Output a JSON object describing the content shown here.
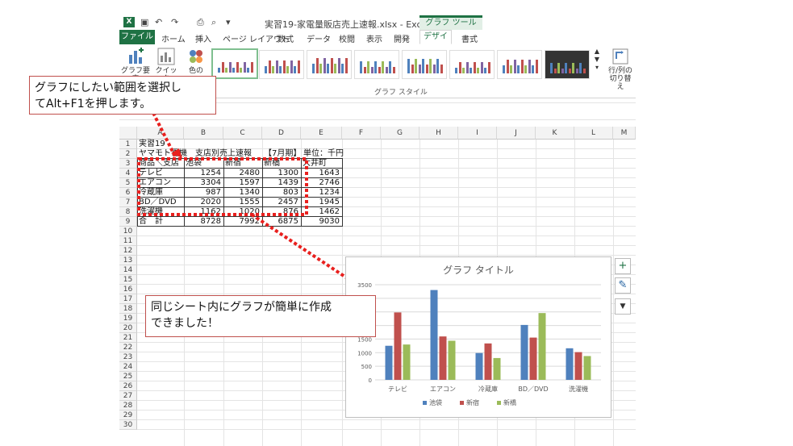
{
  "window": {
    "app_icon_letter": "X",
    "title": "実習19-家電量販店売上速報.xlsx - Excel",
    "context_tools_label": "グラフ ツール"
  },
  "tabs": [
    {
      "label": "ファイル"
    },
    {
      "label": "ホーム"
    },
    {
      "label": "挿入"
    },
    {
      "label": "ページ レイアウト"
    },
    {
      "label": "数式"
    },
    {
      "label": "データ"
    },
    {
      "label": "校閲"
    },
    {
      "label": "表示"
    },
    {
      "label": "開発"
    },
    {
      "label": "デザイン"
    },
    {
      "label": "書式"
    }
  ],
  "ribbon": {
    "add_element": "グラフ要素",
    "quick_layout": "クイック",
    "change_color": "色の",
    "switch_row_col_1": "行/列の",
    "switch_row_col_2": "切り替え",
    "group_styles_label": "グラフ スタイル"
  },
  "sheet": {
    "columns": [
      "A",
      "B",
      "C",
      "D",
      "E",
      "F",
      "G",
      "H",
      "I",
      "J",
      "K",
      "L",
      "M"
    ],
    "rows": [
      "1",
      "2",
      "3",
      "4",
      "5",
      "6",
      "7",
      "8",
      "9",
      "10",
      "11",
      "12",
      "13",
      "14",
      "15",
      "16",
      "17",
      "18",
      "19",
      "20",
      "21",
      "22",
      "23",
      "24",
      "25",
      "26",
      "27",
      "28",
      "29",
      "30"
    ],
    "title": "実習19",
    "subtitle": "ヤマモト電機　支店別売上速報",
    "period": "【7月期】",
    "unit": "単位：千円",
    "headers": [
      "商品＼支店",
      "池袋",
      "新宿",
      "新橋",
      "大井町"
    ],
    "data_rows": [
      {
        "name": "テレビ",
        "values": [
          "1254",
          "2480",
          "1300",
          "1643"
        ]
      },
      {
        "name": "エアコン",
        "values": [
          "3304",
          "1597",
          "1439",
          "2746"
        ]
      },
      {
        "name": "冷蔵庫",
        "values": [
          "987",
          "1340",
          "803",
          "1234"
        ]
      },
      {
        "name": "BD／DVD",
        "values": [
          "2020",
          "1555",
          "2457",
          "1945"
        ]
      },
      {
        "name": "洗濯機",
        "values": [
          "1162",
          "1020",
          "876",
          "1462"
        ]
      }
    ],
    "total_row": {
      "name": "合　計",
      "values": [
        "8728",
        "7992",
        "6875",
        "9030"
      ]
    }
  },
  "callouts": {
    "top_line1": "グラフにしたい範囲を選択し",
    "top_line2": "てAlt+F1を押します。",
    "bottom_line1": "同じシート内にグラフが簡単に作成",
    "bottom_line2": "できました！"
  },
  "chart_data": {
    "type": "bar",
    "title": "グラフ タイトル",
    "categories": [
      "テレビ",
      "エアコン",
      "冷蔵庫",
      "BD／DVD",
      "洗濯機"
    ],
    "series": [
      {
        "name": "池袋",
        "color": "#4f81bd",
        "values": [
          1254,
          3304,
          987,
          2020,
          1162
        ]
      },
      {
        "name": "新宿",
        "color": "#c0504d",
        "values": [
          2480,
          1597,
          1340,
          1555,
          1020
        ]
      },
      {
        "name": "新橋",
        "color": "#9bbb59",
        "values": [
          1300,
          1439,
          803,
          2457,
          876
        ]
      }
    ],
    "ylim": [
      0,
      3500
    ],
    "yticks": [
      "0",
      "500",
      "1000",
      "1500",
      "2000",
      "2500",
      "3000",
      "3500"
    ],
    "legend": "bottom",
    "grid": true
  },
  "chart_side_buttons": {
    "plus_glyph": "+",
    "brush_glyph": "✎",
    "filter_glyph": "▼"
  },
  "colors": {
    "excel_green": "#1f7244",
    "callout_border": "#c0504d",
    "selection_dots": "#e8201e"
  }
}
